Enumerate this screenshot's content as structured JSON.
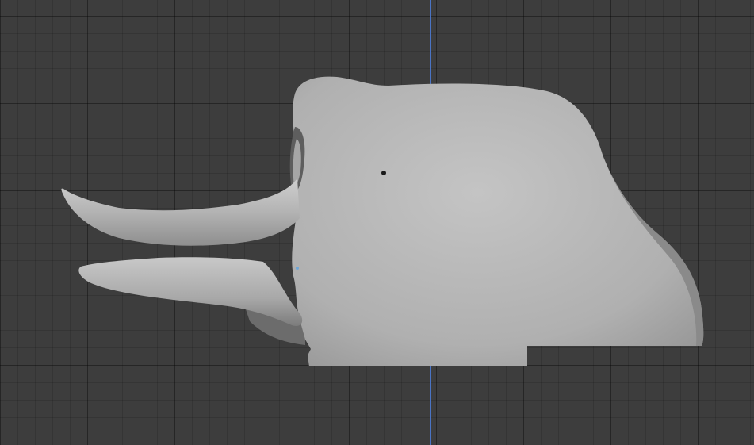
{
  "viewport": {
    "background_color": "#3d3d3d",
    "grid_color": "#2f2f2f",
    "z_axis_color": "#4a74c4",
    "mesh_color": "#b4b4b4",
    "mesh_shadow_color": "#6f6f6f",
    "object_origin_color": "#1a1a1a",
    "vertex_dot_color": "#6fa7d8"
  }
}
